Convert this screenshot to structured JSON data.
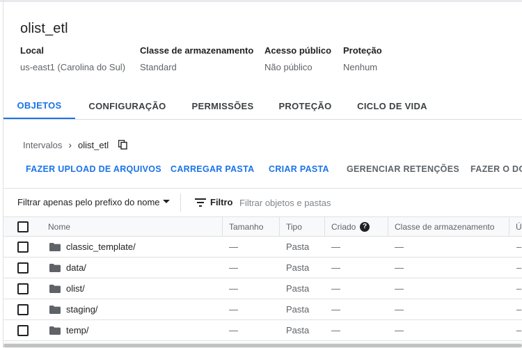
{
  "bucket": {
    "name": "olist_etl"
  },
  "details": [
    {
      "label": "Local",
      "value": "us-east1 (Carolina do Sul)"
    },
    {
      "label": "Classe de armazenamento",
      "value": "Standard"
    },
    {
      "label": "Acesso público",
      "value": "Não público"
    },
    {
      "label": "Proteção",
      "value": "Nenhum"
    }
  ],
  "tabs": [
    "OBJETOS",
    "CONFIGURAÇÃO",
    "PERMISSÕES",
    "PROTEÇÃO",
    "CICLO DE VIDA"
  ],
  "active_tab": "OBJETOS",
  "breadcrumb": {
    "root": "Intervalos",
    "separator": "›",
    "current": "olist_etl"
  },
  "actions": [
    "FAZER UPLOAD DE ARQUIVOS",
    "CARREGAR PASTA",
    "CRIAR PASTA",
    "GERENCIAR RETENÇÕES",
    "FAZER O DOW"
  ],
  "filter": {
    "prefix_label": "Filtrar apenas pelo prefixo do nome",
    "filter_label": "Filtro",
    "placeholder": "Filtrar objetos e pastas"
  },
  "table": {
    "columns": [
      "Nome",
      "Tamanho",
      "Tipo",
      "Criado",
      "Classe de armazenamento",
      "Ú"
    ],
    "help_glyph": "?",
    "rows": [
      {
        "name": "classic_template/",
        "size": "—",
        "type": "Pasta",
        "created": "—",
        "storage_class": "—",
        "last": "–"
      },
      {
        "name": "data/",
        "size": "—",
        "type": "Pasta",
        "created": "—",
        "storage_class": "—",
        "last": "–"
      },
      {
        "name": "olist/",
        "size": "—",
        "type": "Pasta",
        "created": "—",
        "storage_class": "—",
        "last": "–"
      },
      {
        "name": "staging/",
        "size": "—",
        "type": "Pasta",
        "created": "—",
        "storage_class": "—",
        "last": "–"
      },
      {
        "name": "temp/",
        "size": "—",
        "type": "Pasta",
        "created": "—",
        "storage_class": "—",
        "last": "–"
      }
    ]
  },
  "icons": {
    "copy": "copy-icon",
    "filter": "filter-list-icon",
    "folder": "folder-icon",
    "help": "help-circle-icon",
    "dropdown": "caret-down-icon"
  },
  "colors": {
    "accent": "#1a73e8",
    "text": "#202124",
    "muted": "#5f6368"
  }
}
